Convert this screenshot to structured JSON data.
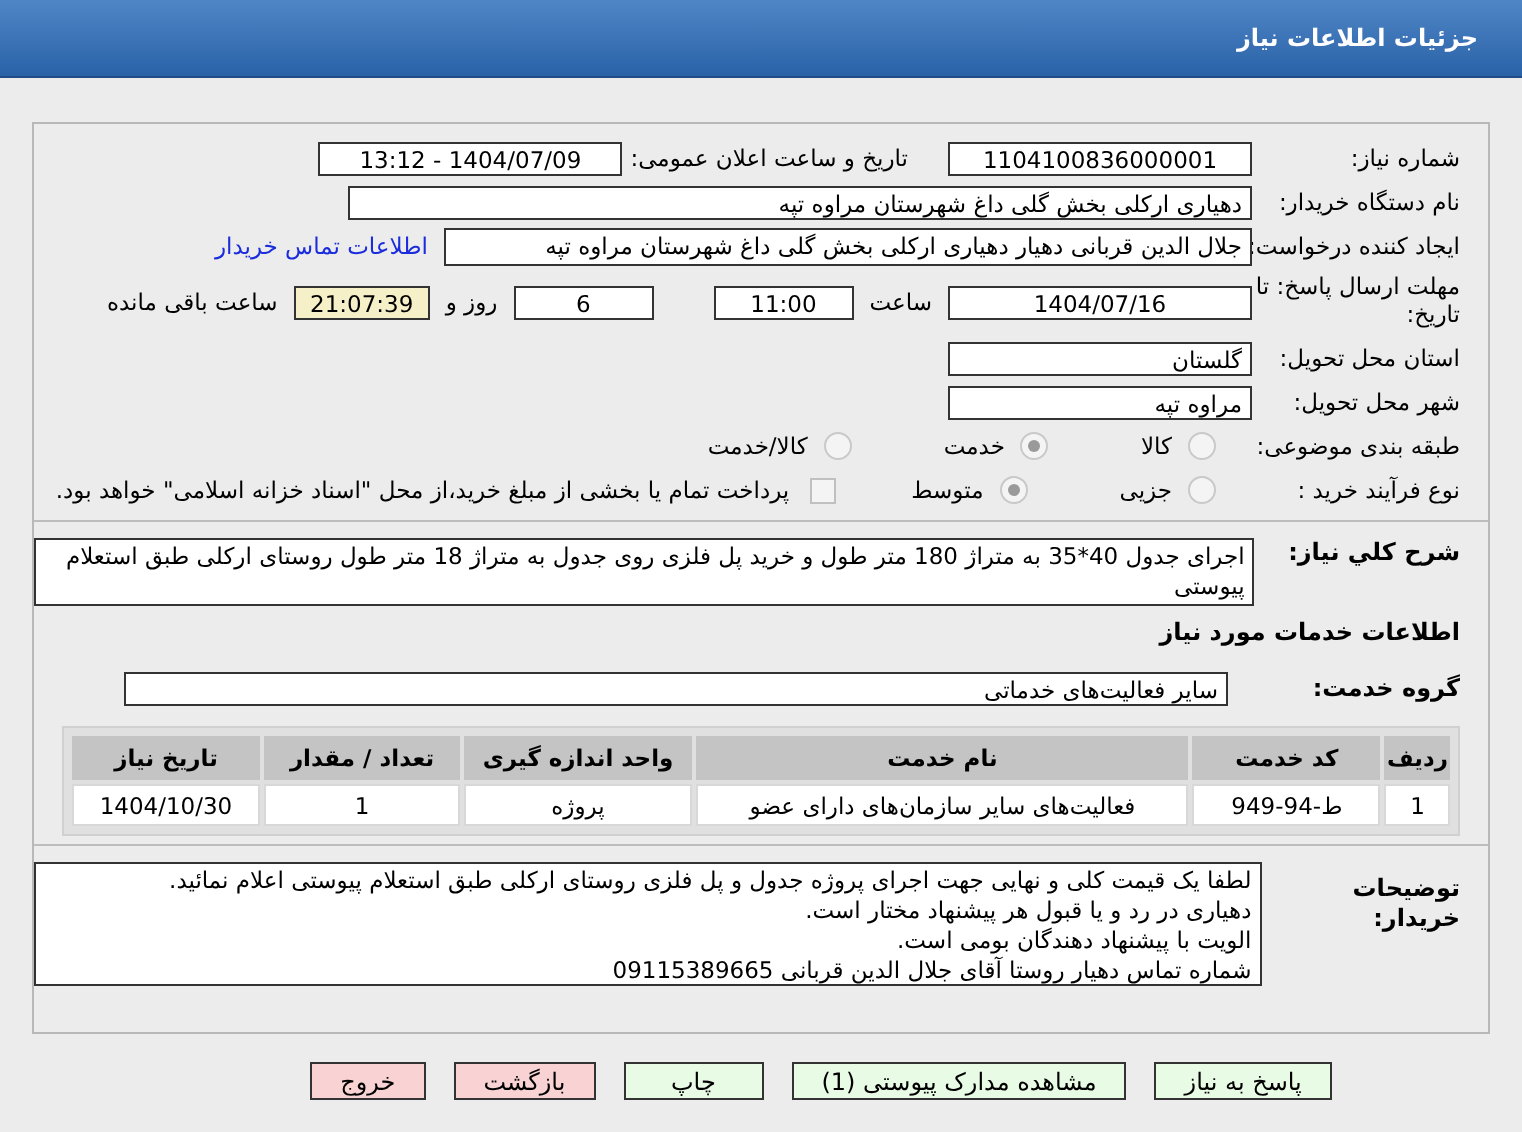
{
  "header": {
    "title": "جزئیات اطلاعات نیاز"
  },
  "need_number": {
    "label": "شماره نیاز:",
    "value": "1104100836000001"
  },
  "announce": {
    "label": "تاریخ و ساعت اعلان عمومی:",
    "value": "1404/07/09 - 13:12"
  },
  "buyer_org": {
    "label": "نام دستگاه خریدار:",
    "value": "دهیاری ارکلی بخش گلی داغ شهرستان مراوه تپه"
  },
  "requester": {
    "label": "ایجاد کننده درخواست:",
    "value": "جلال الدین قربانی دهیار دهیاری ارکلی بخش گلی داغ شهرستان مراوه تپه",
    "link": "اطلاعات تماس خریدار"
  },
  "deadline": {
    "label": "مهلت ارسال پاسخ: تا تاریخ:",
    "date": "1404/07/16",
    "time_label": "ساعت",
    "time": "11:00",
    "days": "6",
    "days_label": "روز و",
    "remaining": "21:07:39",
    "remaining_label": "ساعت باقی مانده"
  },
  "province": {
    "label": "استان محل تحویل:",
    "value": "گلستان"
  },
  "city": {
    "label": "شهر محل تحویل:",
    "value": "مراوه تپه"
  },
  "category": {
    "label": "طبقه بندی موضوعی:",
    "options": [
      {
        "label": "کالا",
        "selected": false
      },
      {
        "label": "خدمت",
        "selected": true
      },
      {
        "label": "کالا/خدمت",
        "selected": false
      }
    ]
  },
  "purchase_type": {
    "label": "نوع فرآیند خرید :",
    "options": [
      {
        "label": "جزیی",
        "selected": false
      },
      {
        "label": "متوسط",
        "selected": true
      }
    ],
    "payment": {
      "label": "پرداخت تمام یا بخشی از مبلغ خرید،از محل \"اسناد خزانه اسلامی\" خواهد بود.",
      "checked": false
    }
  },
  "description": {
    "label": "شرح کلي نياز:",
    "value": "اجرای جدول 40*35 به متراژ 180 متر طول و خرید پل فلزی روی جدول به متراژ 18 متر طول روستای ارکلی طبق استعلام پیوستی"
  },
  "services_heading": "اطلاعات خدمات مورد نیاز",
  "service_group": {
    "label": "گروه خدمت:",
    "value": "سایر فعالیت‌های خدماتی"
  },
  "table": {
    "columns": [
      "ردیف",
      "کد خدمت",
      "نام خدمت",
      "واحد اندازه گیری",
      "تعداد / مقدار",
      "تاریخ نیاز"
    ],
    "rows": [
      [
        "1",
        "ط-94-949",
        "فعالیت‌های سایر سازمان‌های دارای عضو",
        "پروژه",
        "1",
        "1404/10/30"
      ]
    ]
  },
  "buyer_notes": {
    "label": "توضیحات خریدار:",
    "lines": [
      "لطفا یک قیمت کلی و نهایی جهت اجرای پروژه جدول و پل فلزی روستای ارکلی طبق استعلام پیوستی اعلام نمائید.",
      "دهیاری در رد و یا قبول هر پیشنهاد مختار است.",
      "الویت با پیشنهاد دهندگان بومی است.",
      "شماره تماس دهیار روستا آقای جلال الدین قربانی 09115389665"
    ]
  },
  "buttons": [
    {
      "label": "پاسخ به نیاز",
      "kind": "green"
    },
    {
      "label": "مشاهده مدارک پیوستی (1)",
      "kind": "green"
    },
    {
      "label": "چاپ",
      "kind": "green"
    },
    {
      "label": "بازگشت",
      "kind": "red"
    },
    {
      "label": "خروج",
      "kind": "red"
    }
  ]
}
